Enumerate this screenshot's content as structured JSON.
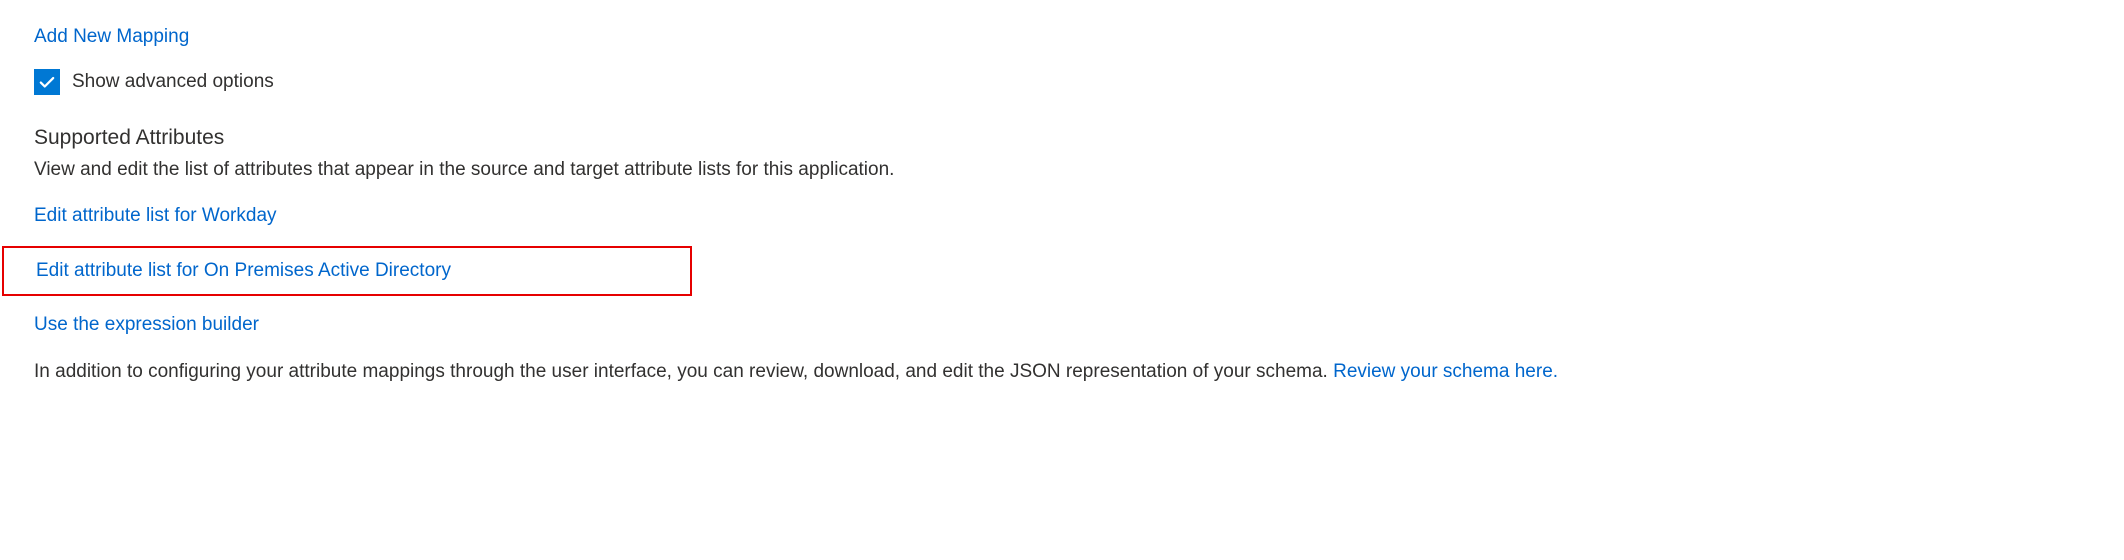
{
  "links": {
    "add_new_mapping": "Add New Mapping",
    "edit_workday": "Edit attribute list for Workday",
    "edit_onprem_ad": "Edit attribute list for On Premises Active Directory",
    "expression_builder": "Use the expression builder",
    "review_schema": "Review your schema here."
  },
  "checkbox": {
    "show_advanced_label": "Show advanced options"
  },
  "section": {
    "heading": "Supported Attributes",
    "description": "View and edit the list of attributes that appear in the source and target attribute lists for this application."
  },
  "paragraph": {
    "schema_info": "In addition to configuring your attribute mappings through the user interface, you can review, download, and edit the JSON representation of your schema. "
  }
}
